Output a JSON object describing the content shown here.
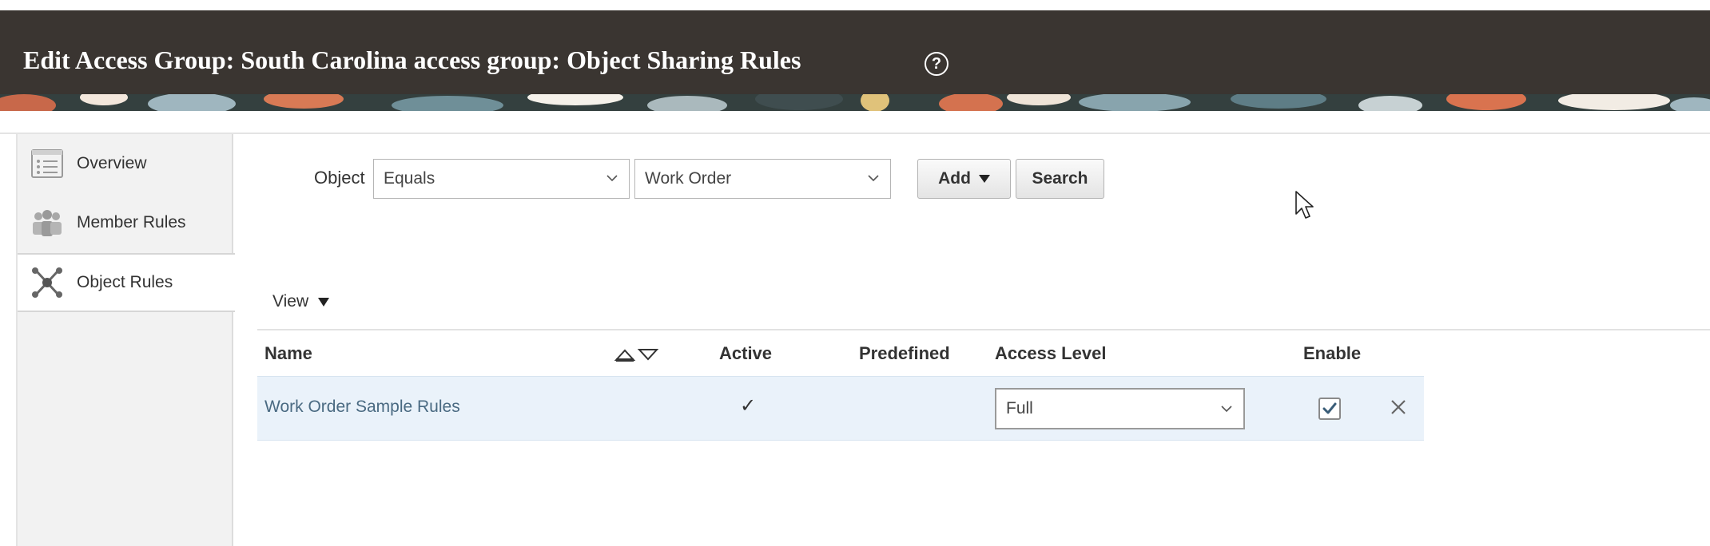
{
  "header": {
    "title": "Edit Access Group: South Carolina access group: Object Sharing Rules",
    "help_icon": "help-circle-icon"
  },
  "sidebar": {
    "items": [
      {
        "label": "Overview",
        "icon": "list-icon"
      },
      {
        "label": "Member Rules",
        "icon": "people-icon"
      },
      {
        "label": "Object Rules",
        "icon": "object-network-icon",
        "selected": true
      }
    ]
  },
  "filter": {
    "label": "Object",
    "operator": "Equals",
    "value": "Work Order",
    "add_label": "Add",
    "search_label": "Search"
  },
  "table": {
    "view_label": "View",
    "columns": [
      "Name",
      "Active",
      "Predefined",
      "Access Level",
      "Enable"
    ],
    "rows": [
      {
        "name": "Work Order Sample Rules",
        "active": "✓",
        "predefined": "",
        "access_level": "Full",
        "enable": true
      }
    ]
  },
  "colors": {
    "header_bg": "#3a3531",
    "row_selected": "#eaf2fa",
    "link": "#4a6a82"
  }
}
